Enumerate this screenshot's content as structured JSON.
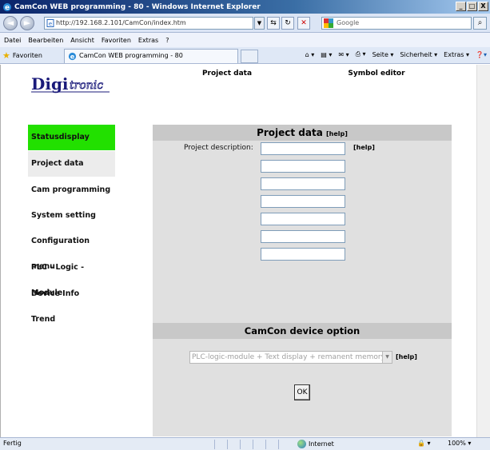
{
  "window": {
    "title": "CamCon WEB programming - 80 - Windows Internet Explorer",
    "min_glyph": "_",
    "max_glyph": "□",
    "close_glyph": "X"
  },
  "toolbar": {
    "back_glyph": "◄",
    "forward_glyph": "►",
    "address": "http://192.168.2.101/CamCon/index.htm",
    "search_placeholder": "Google",
    "dropdown_glyph": "▼",
    "refresh_glyph": "↻",
    "compat_glyph": "⇆",
    "stop_glyph": "✕",
    "search_glyph": "⌕"
  },
  "menubar": [
    "Datei",
    "Bearbeiten",
    "Ansicht",
    "Favoriten",
    "Extras",
    "?"
  ],
  "favbar": {
    "favorites_label": "Favoriten",
    "tab_title": "CamCon WEB programming - 80",
    "commands": [
      "Seite ▾",
      "Sicherheit ▾",
      "Extras ▾"
    ],
    "home_glyph": "⌂ ▾",
    "feeds_glyph": "▤ ▾",
    "mail_glyph": "✉ ▾",
    "print_glyph": "⎙ ▾",
    "help_glyph": "❓▾"
  },
  "logo": {
    "text": "Digitronic"
  },
  "top_tabs": {
    "project": "Project data",
    "symbol": "Symbol editor"
  },
  "nav": {
    "items": [
      {
        "label": "Statusdisplay"
      },
      {
        "label": "Project data"
      },
      {
        "label": "Cam programming"
      },
      {
        "label": "System setting"
      },
      {
        "label": "Configuration menu"
      },
      {
        "label": "PLC - Logic - Module"
      },
      {
        "label": "Device Info"
      },
      {
        "label": "Trend"
      }
    ]
  },
  "panel": {
    "title": "Project data",
    "title_help": "[help]",
    "description_label": "Project description:",
    "description_help": "[help]",
    "description_fields": [
      "",
      "",
      "",
      "",
      "",
      "",
      ""
    ],
    "device_title": "CamCon device option",
    "device_select": "PLC-logic-module + Text display + remanent memory",
    "device_help": "[help]",
    "ok_label": "OK"
  },
  "statusbar": {
    "text": "Fertig",
    "zone": "Internet",
    "protected_glyph": "🔒 ▾",
    "zoom": "100%  ▾"
  },
  "colors": {
    "active_nav": "#22e000",
    "panel_bg": "#e0e0e0",
    "panel_header": "#c8c8c8"
  }
}
